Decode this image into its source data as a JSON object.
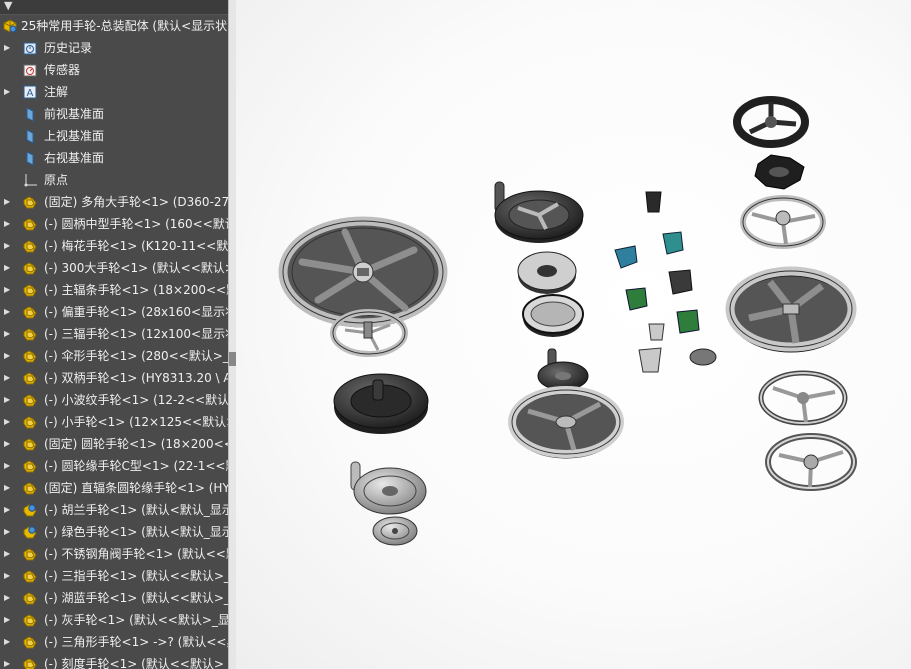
{
  "tree": {
    "root_label": "25种常用手轮-总装配体  (默认<显示状",
    "items": [
      {
        "label": "历史记录",
        "icon": "history-icon",
        "arrow": true
      },
      {
        "label": "传感器",
        "icon": "sensor-icon",
        "arrow": false
      },
      {
        "label": "注解",
        "icon": "annotation-icon",
        "arrow": true
      },
      {
        "label": "前视基准面",
        "icon": "plane-icon",
        "arrow": false
      },
      {
        "label": "上视基准面",
        "icon": "plane-icon",
        "arrow": false
      },
      {
        "label": "右视基准面",
        "icon": "plane-icon",
        "arrow": false
      },
      {
        "label": "原点",
        "icon": "origin-icon",
        "arrow": false
      },
      {
        "label": "(固定) 多角大手轮<1> (D360-27-",
        "icon": "part-icon",
        "arrow": true
      },
      {
        "label": "(-) 圆柄中型手轮<1> (160<<默认",
        "icon": "part-icon",
        "arrow": true
      },
      {
        "label": "(-) 梅花手轮<1> (K120-11<<默认",
        "icon": "part-icon",
        "arrow": true
      },
      {
        "label": "(-) 300大手轮<1> (默认<<默认>",
        "icon": "part-icon",
        "arrow": true
      },
      {
        "label": "(-) 主辐条手轮<1> (18×200<<默",
        "icon": "part-icon",
        "arrow": true
      },
      {
        "label": "(-) 偏重手轮<1> (28x160<显示状",
        "icon": "part-icon",
        "arrow": true
      },
      {
        "label": "(-) 三辐手轮<1> (12x100<显示状",
        "icon": "part-icon",
        "arrow": true
      },
      {
        "label": "(-) 伞形手轮<1> (280<<默认>_显",
        "icon": "part-icon",
        "arrow": true
      },
      {
        "label": "(-) 双柄手轮<1> (HY8313.20 \\ A",
        "icon": "part-icon",
        "arrow": true
      },
      {
        "label": "(-) 小波纹手轮<1> (12-2<<默认>",
        "icon": "part-icon",
        "arrow": true
      },
      {
        "label": "(-) 小手轮<1> (12×125<<默认>_",
        "icon": "part-icon",
        "arrow": true
      },
      {
        "label": "(固定) 圆轮手轮<1> (18×200<<黑",
        "icon": "part-icon",
        "arrow": true
      },
      {
        "label": "(-) 圆轮缘手轮C型<1> (22-1<<默",
        "icon": "part-icon",
        "arrow": true
      },
      {
        "label": "(固定) 直辐条圆轮缘手轮<1> (HY",
        "icon": "part-icon",
        "arrow": true
      },
      {
        "label": "(-) 胡兰手轮<1> (默认<默认_显示",
        "icon": "assembly-icon",
        "arrow": true
      },
      {
        "label": "(-) 绿色手轮<1> (默认<默认_显示",
        "icon": "assembly-icon",
        "arrow": true
      },
      {
        "label": "(-) 不锈钢角阀手轮<1> (默认<<默",
        "icon": "part-icon",
        "arrow": true
      },
      {
        "label": "(-) 三指手轮<1> (默认<<默认>_显",
        "icon": "part-icon",
        "arrow": true
      },
      {
        "label": "(-) 湖蓝手轮<1> (默认<<默认>_显",
        "icon": "part-icon",
        "arrow": true
      },
      {
        "label": "(-) 灰手轮<1> (默认<<默认>_显示",
        "icon": "part-icon",
        "arrow": true
      },
      {
        "label": "(-) 三角形手轮<1> ->? (默认<<黑",
        "icon": "part-icon",
        "arrow": true
      },
      {
        "label": "(-) 刻度手轮<1> (默认<<默认>_",
        "icon": "part-icon",
        "arrow": true
      }
    ]
  },
  "colors": {
    "tree_bg": "#4a4a4a",
    "text": "#f0f0f0",
    "part_yellow": "#e8b800",
    "metal_gray": "#9a9a9a",
    "dark": "#2e2e2e",
    "teal": "#2f8f8f",
    "green": "#2e7d3a"
  }
}
